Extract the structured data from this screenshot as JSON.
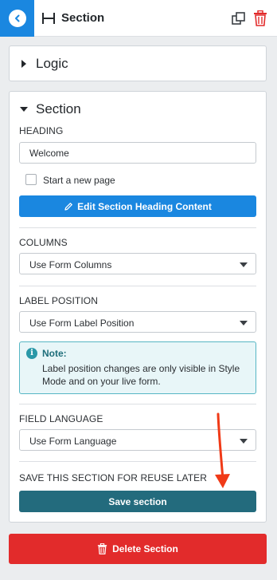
{
  "header": {
    "title": "Section",
    "back_icon": "chevron-left-icon",
    "section_icon": "section-icon",
    "duplicate_icon": "duplicate-icon",
    "delete_icon": "trash-icon"
  },
  "logic": {
    "title": "Logic"
  },
  "section": {
    "title": "Section",
    "heading_label": "HEADING",
    "heading_value": "Welcome",
    "new_page_label": "Start a new page",
    "new_page_checked": false,
    "edit_heading_button": "Edit Section Heading Content",
    "columns_label": "COLUMNS",
    "columns_value": "Use Form Columns",
    "label_position_label": "LABEL POSITION",
    "label_position_value": "Use Form Label Position",
    "note_title": "Note:",
    "note_body": "Label position changes are only visible in Style Mode and on your live form.",
    "field_language_label": "FIELD LANGUAGE",
    "field_language_value": "Use Form Language",
    "save_reuse_label": "SAVE THIS SECTION FOR REUSE LATER",
    "save_button": "Save section"
  },
  "footer": {
    "delete_button": "Delete Section"
  },
  "colors": {
    "primary_blue": "#1a87e0",
    "teal_button": "#236b7d",
    "danger_red": "#e22b2b",
    "note_border": "#57b6c4",
    "annotation_arrow": "#f03a17"
  }
}
